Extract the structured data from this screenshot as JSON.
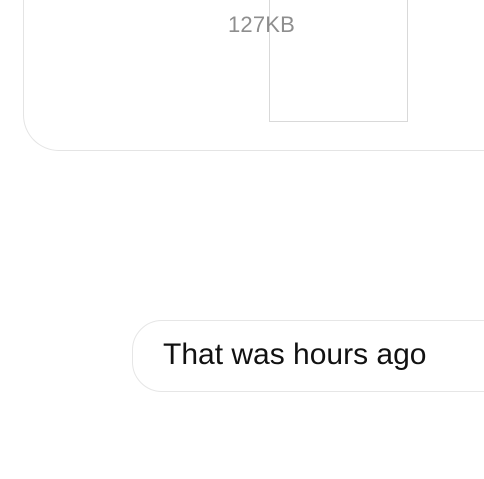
{
  "attachment": {
    "file_size": "127KB"
  },
  "message": {
    "text": "That was hours ago"
  }
}
